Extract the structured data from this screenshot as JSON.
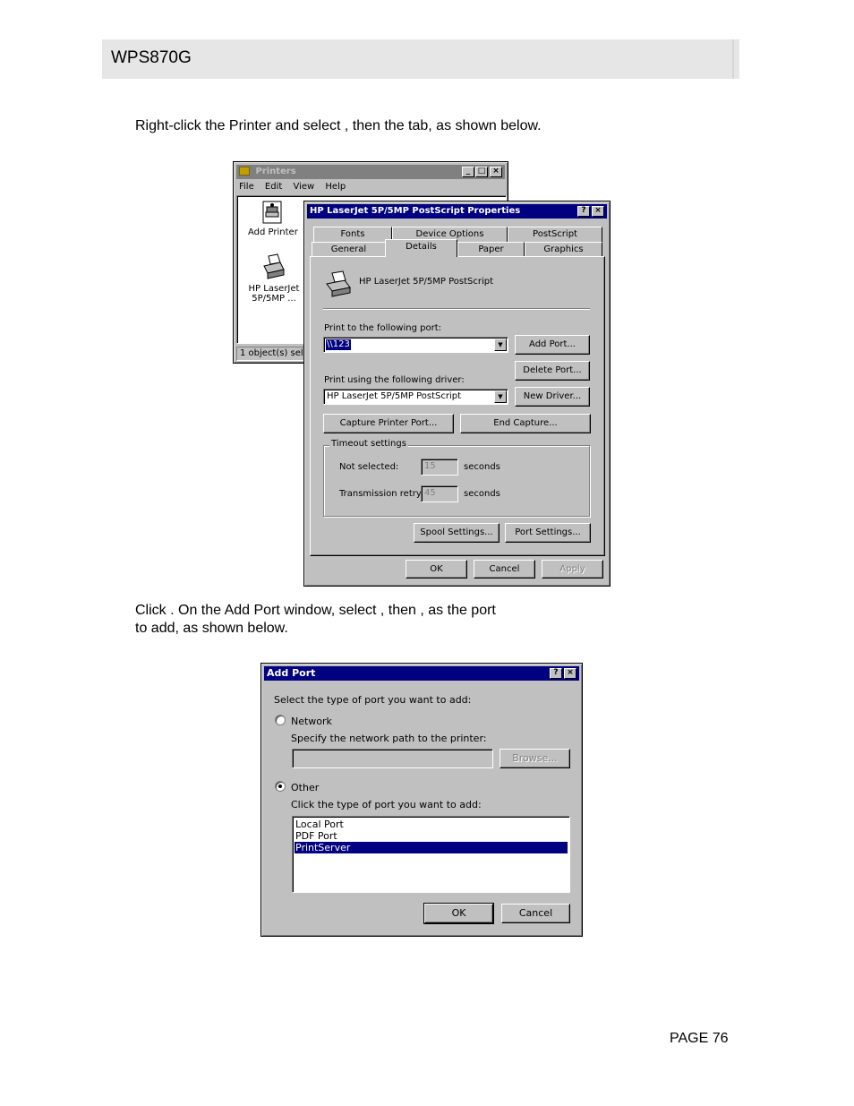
{
  "header": {
    "title": "WPS870G"
  },
  "text": {
    "p1": "Right-click the Printer and select              , then the            tab, as shown below.",
    "p2a": "Click              . On the Add Port window, select          , then                         , as the port",
    "p2b": "to add, as shown below."
  },
  "footer": {
    "page": "PAGE 76"
  },
  "printers_window": {
    "title": "Printers",
    "menu": [
      "File",
      "Edit",
      "View",
      "Help"
    ],
    "icons": [
      {
        "label": "Add Printer"
      },
      {
        "label": "HP LaserJet 5P/5MP ..."
      }
    ],
    "status": "1 object(s) selec"
  },
  "properties_dialog": {
    "title": "HP LaserJet 5P/5MP PostScript Properties",
    "tabs_row1": [
      "Fonts",
      "Device Options",
      "PostScript"
    ],
    "tabs_row2": [
      "General",
      "Details",
      "Paper",
      "Graphics"
    ],
    "selected_tab": "Details",
    "printer_name": "HP LaserJet 5P/5MP PostScript",
    "port_label": "Print to the following port:",
    "port_value": "\\\\123",
    "add_port": "Add Port...",
    "delete_port": "Delete Port...",
    "driver_label": "Print using the following driver:",
    "driver_value": "HP LaserJet 5P/5MP PostScript",
    "new_driver": "New Driver...",
    "capture_port": "Capture Printer Port...",
    "end_capture": "End Capture...",
    "timeout_title": "Timeout settings",
    "not_selected_label": "Not selected:",
    "not_selected_value": "15",
    "transmission_label": "Transmission retry:",
    "transmission_value": "45",
    "seconds": "seconds",
    "spool_settings": "Spool Settings...",
    "port_settings": "Port Settings...",
    "ok": "OK",
    "cancel": "Cancel",
    "apply": "Apply"
  },
  "add_port_dialog": {
    "title": "Add Port",
    "prompt": "Select the type of port you want to add:",
    "network_label": "Network",
    "network_path_label": "Specify the network path to the printer:",
    "network_path_value": "",
    "browse": "Browse...",
    "other_label": "Other",
    "other_prompt": "Click the type of port you want to add:",
    "port_types": [
      "Local Port",
      "PDF Port",
      "PrintServer"
    ],
    "selected_port_type": "PrintServer",
    "ok": "OK",
    "cancel": "Cancel"
  }
}
